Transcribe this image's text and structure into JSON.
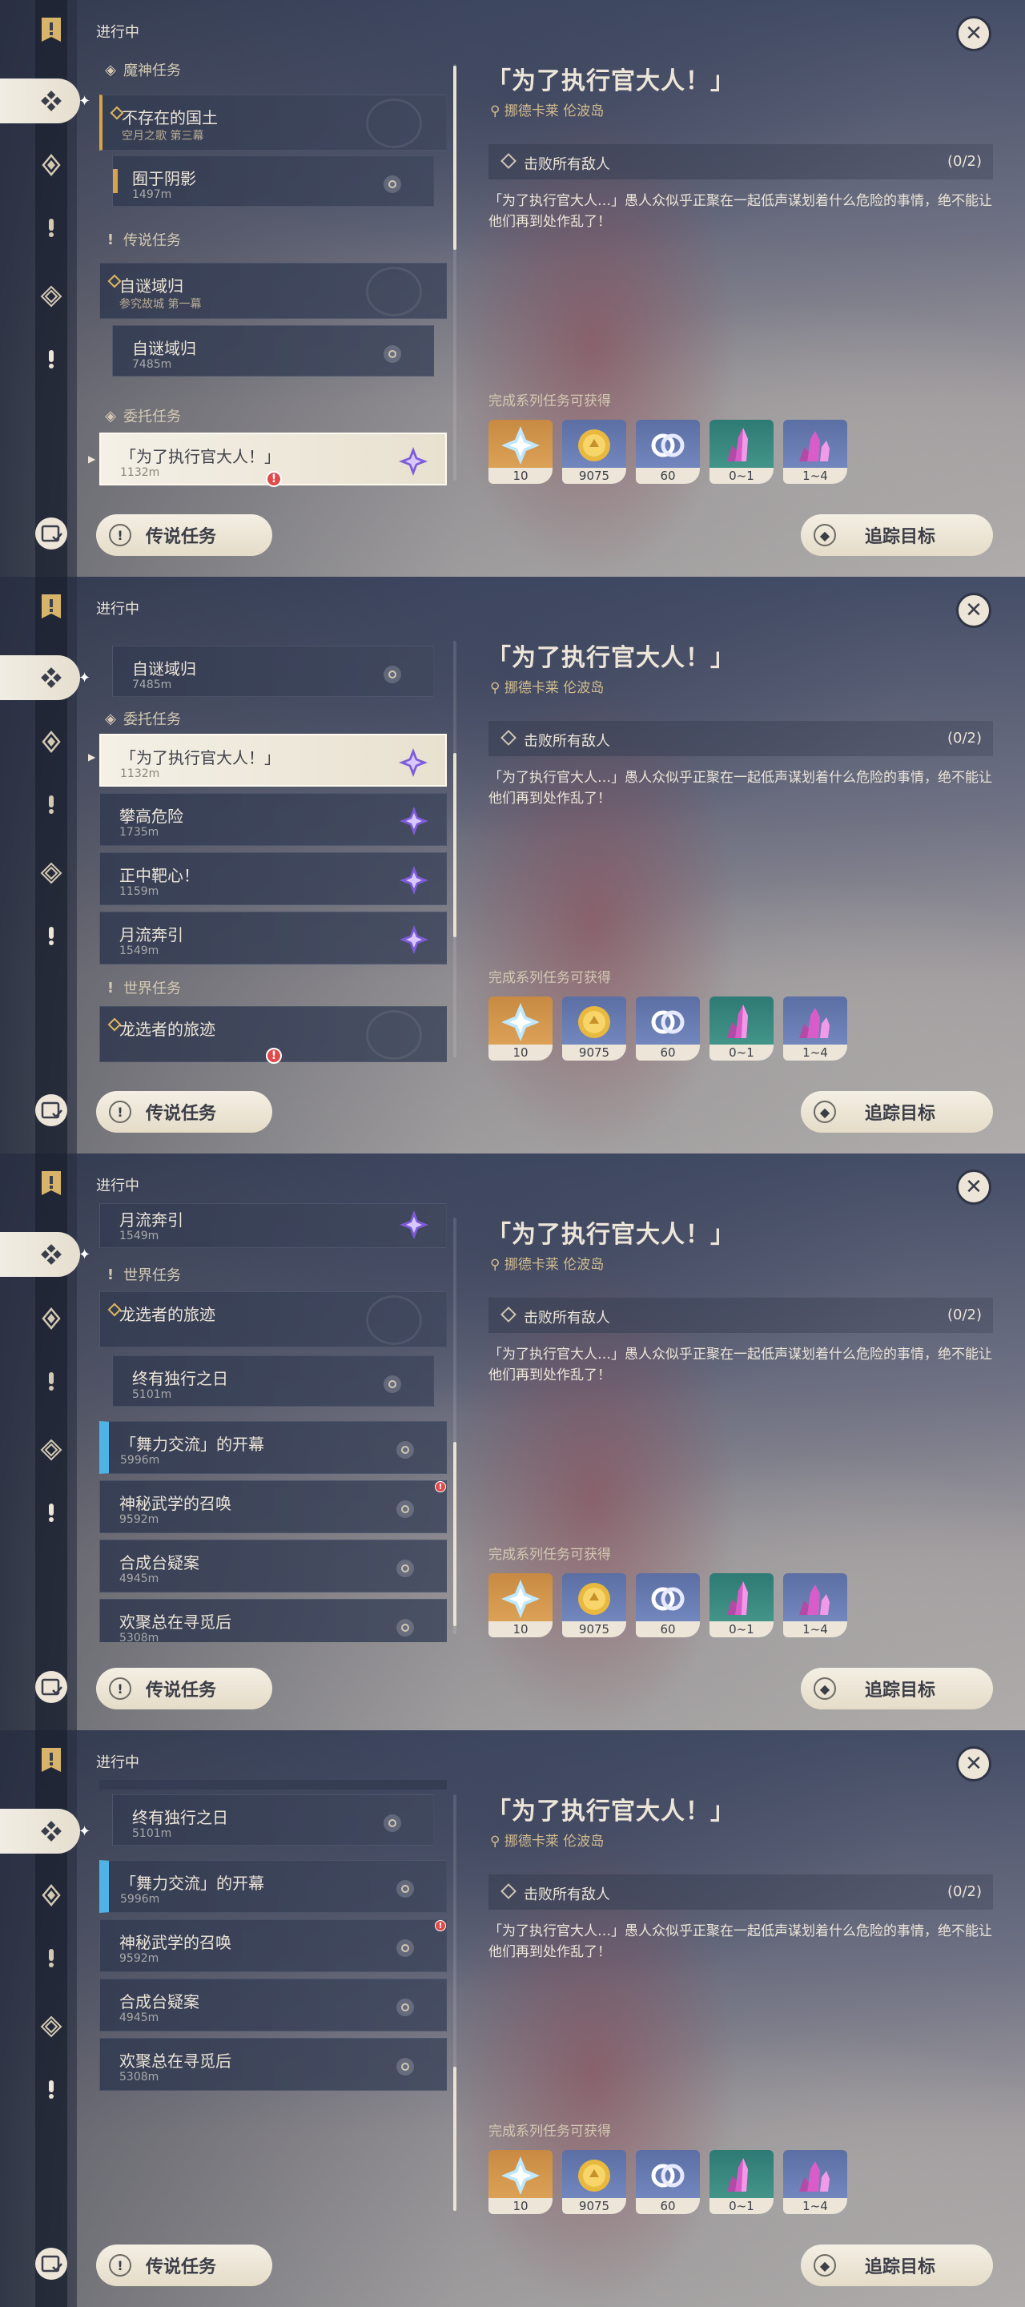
{
  "colors": {
    "accent_gold": "#d8a34a",
    "selected_bg": "#f4f0e6",
    "badge_red": "#e04a4a",
    "blue_marker": "#4fb3e8"
  },
  "common": {
    "section_title": "进行中",
    "legend_button": "传说任务",
    "track_button": "追踪目标",
    "close_label": "✕"
  },
  "detail": {
    "title": "「为了执行官大人！」",
    "location": "挪德卡莱 伦波岛",
    "objective": "击败所有敌人",
    "progress": "(0/2)",
    "description": "「为了执行官大人…」愚人众似乎正聚在一起低声谋划着什么危险的事情，绝不能让他们再到处作乱了！",
    "rewards_label": "完成系列任务可获得",
    "rewards": [
      {
        "icon": "primogem-icon",
        "count": "10",
        "bg": "gold"
      },
      {
        "icon": "mora-icon",
        "count": "9075",
        "bg": "blue"
      },
      {
        "icon": "exp-icon",
        "count": "60",
        "bg": "blue"
      },
      {
        "icon": "crystal-icon",
        "count": "0~1",
        "bg": "green"
      },
      {
        "icon": "crystal-cluster-icon",
        "count": "1~4",
        "bg": "blue"
      }
    ]
  },
  "categories": {
    "archon": "魔神任务",
    "legend": "传说任务",
    "commission": "委托任务",
    "world": "世界任务"
  },
  "quests": {
    "q1": {
      "title": "不存在的国土",
      "sub": "空月之歌 第三幕"
    },
    "q2": {
      "title": "囿于阴影",
      "sub": "1497m"
    },
    "q3": {
      "title": "自谜域归",
      "sub": "参究故城 第一幕"
    },
    "q4": {
      "title": "自谜域归",
      "sub": "7485m"
    },
    "q5": {
      "title": "「为了执行官大人！」",
      "sub": "1132m"
    },
    "q6": {
      "title": "攀高危险",
      "sub": "1735m"
    },
    "q7": {
      "title": "正中靶心！",
      "sub": "1159m"
    },
    "q8": {
      "title": "月流奔引",
      "sub": "1549m"
    },
    "q9": {
      "title": "龙选者的旅迹",
      "sub": ""
    },
    "q10": {
      "title": "终有独行之日",
      "sub": "5101m"
    },
    "q11": {
      "title": "「舞力交流」的开幕",
      "sub": "5996m"
    },
    "q12": {
      "title": "神秘武学的召唤",
      "sub": "9592m"
    },
    "q13": {
      "title": "合成台疑案",
      "sub": "4945m"
    },
    "q14": {
      "title": "欢聚总在寻觅后",
      "sub": "5308m"
    }
  }
}
